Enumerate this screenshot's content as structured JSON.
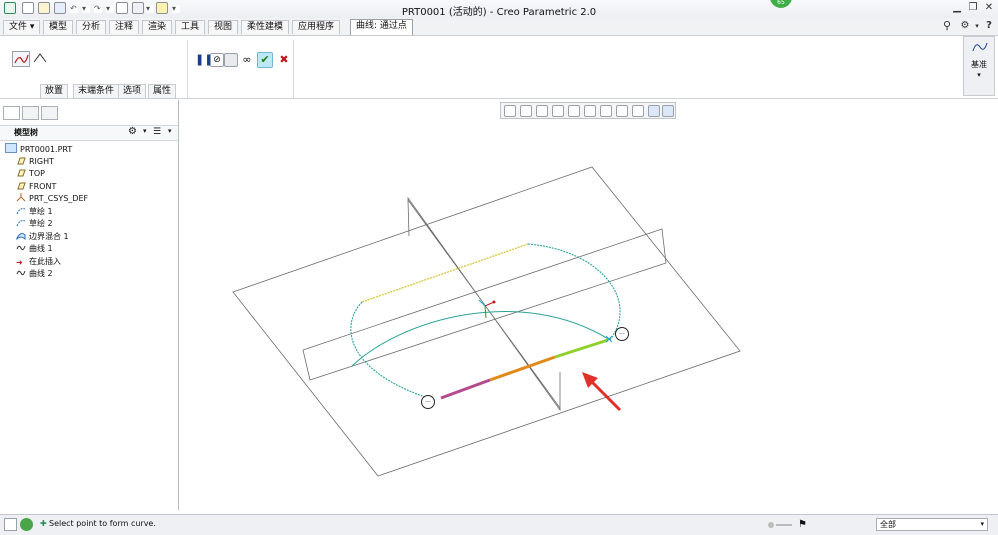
{
  "window": {
    "title": "PRT0001 (活动的) - Creo Parametric 2.0",
    "badge": "65"
  },
  "menu": {
    "tabs": [
      "文件",
      "模型",
      "分析",
      "注释",
      "渲染",
      "工具",
      "视图",
      "柔性建模",
      "应用程序"
    ],
    "active_tab": "曲线: 通过点"
  },
  "ribbon": {
    "subtabs": [
      "放置",
      "末端条件",
      "选项",
      "属性"
    ],
    "datum_label": "基准"
  },
  "model_tree": {
    "header": "模型树",
    "root": "PRT0001.PRT",
    "items": [
      "RIGHT",
      "TOP",
      "FRONT",
      "PRT_CSYS_DEF",
      "草绘 1",
      "草绘 2",
      "边界混合 1",
      "曲线 1",
      "在此插入",
      "曲线 2"
    ]
  },
  "status": {
    "message": "Select point to form curve.",
    "filter": "全部"
  },
  "colors": {
    "accent_check": "#1e7a1e",
    "cancel": "#c0181b",
    "arrow": "#e0302a",
    "badge": "#3fae49"
  }
}
